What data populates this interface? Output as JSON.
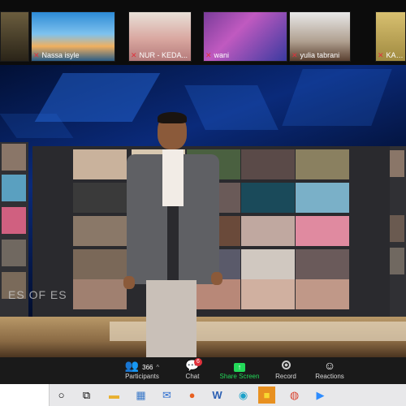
{
  "participants_strip": [
    {
      "name": "",
      "muted": false
    },
    {
      "name": "Nassa isyle",
      "muted": true
    },
    {
      "name": "NUR - KEDA...",
      "muted": true
    },
    {
      "name": "wani",
      "muted": true
    },
    {
      "name": "yulia tabrani",
      "muted": true
    },
    {
      "name": "KAK IT",
      "muted": true
    }
  ],
  "stage": {
    "watermark": "ES OF ES"
  },
  "toolbar": {
    "participants_label": "Participants",
    "participants_count": "366",
    "chat_label": "Chat",
    "chat_badge": "6",
    "share_label": "Share Screen",
    "record_label": "Record",
    "reactions_label": "Reactions"
  },
  "taskbar": {
    "icons": [
      "search-circle-icon",
      "task-view-icon",
      "file-explorer-icon",
      "store-icon",
      "mail-icon",
      "firefox-icon",
      "word-icon",
      "edge-icon",
      "sticky-notes-icon",
      "chrome-icon",
      "zoom-icon"
    ]
  },
  "colors": {
    "share_green": "#23d959",
    "badge_red": "#e0323c",
    "toolbar_bg": "#1a1a1a"
  }
}
